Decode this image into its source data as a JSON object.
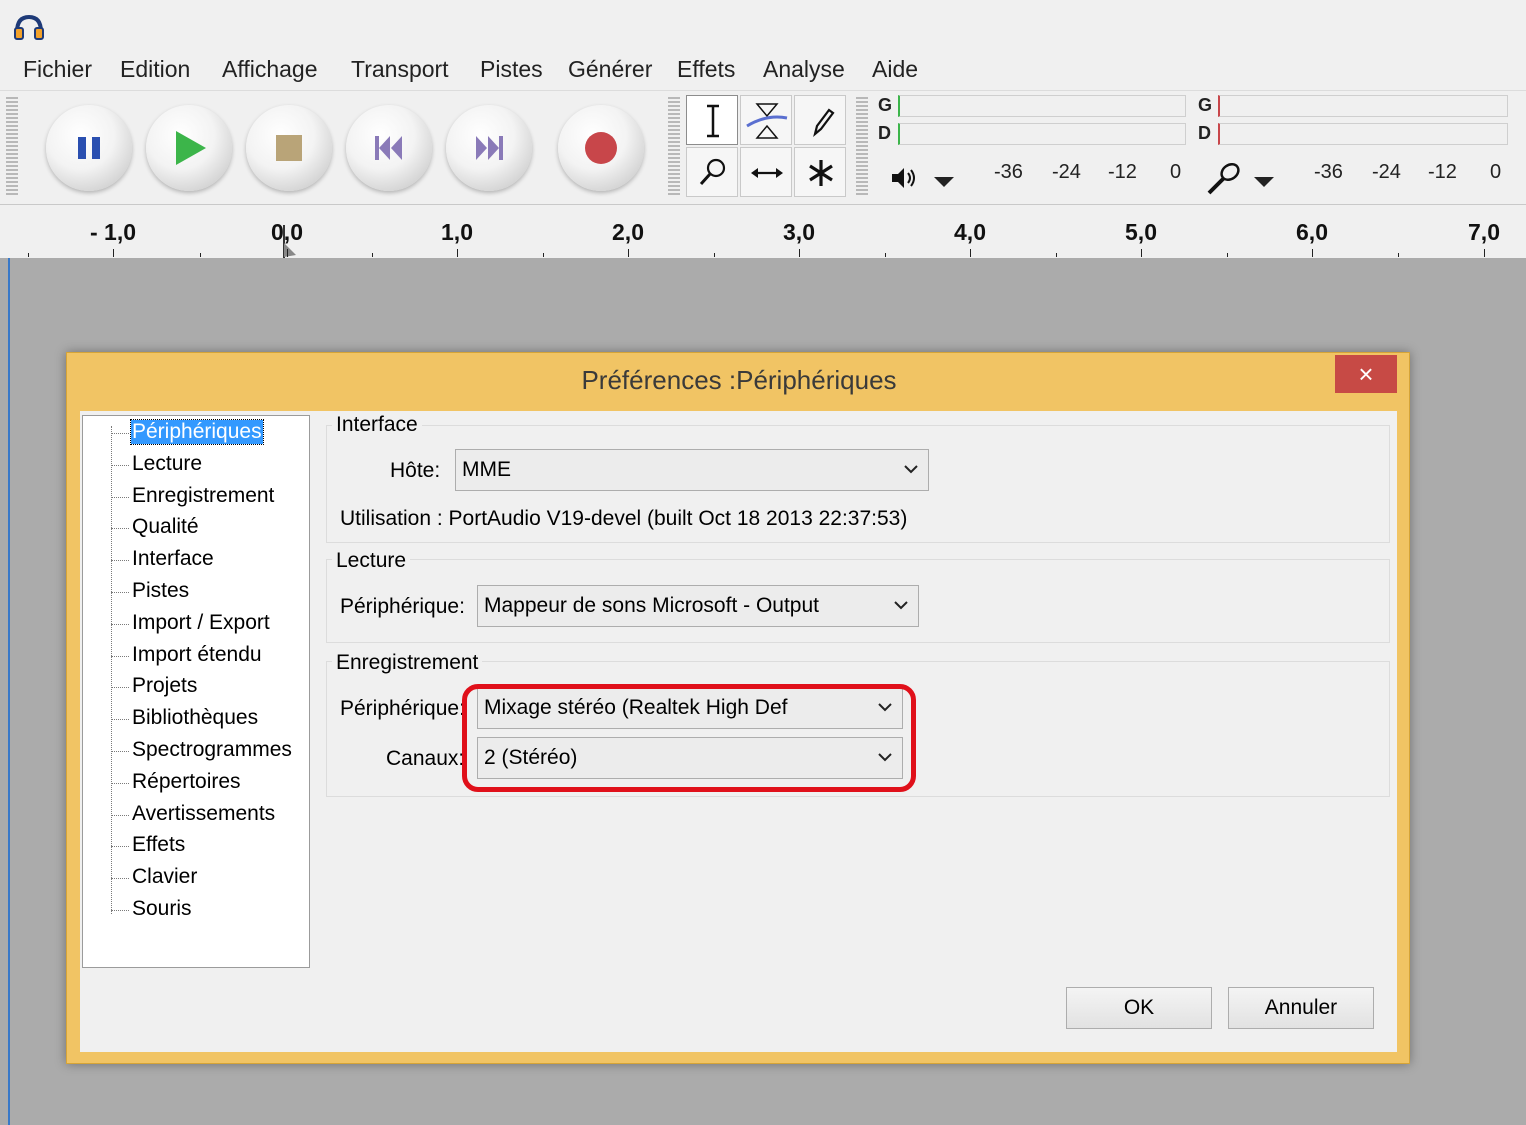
{
  "menu": [
    "Fichier",
    "Edition",
    "Affichage",
    "Transport",
    "Pistes",
    "Générer",
    "Effets",
    "Analyse",
    "Aide"
  ],
  "meters": {
    "left_channel": "G",
    "right_channel": "D",
    "ticks": [
      "-36",
      "-24",
      "-12",
      "0"
    ],
    "playback_icon": "speaker-icon",
    "record_icon": "microphone-icon"
  },
  "ruler": {
    "labels": [
      "- 1,0",
      "0,0",
      "1,0",
      "2,0",
      "3,0",
      "4,0",
      "5,0",
      "6,0",
      "7,0"
    ]
  },
  "dialog": {
    "title": "Préférences :Périphériques",
    "close_label": "×",
    "tree": [
      "Périphériques",
      "Lecture",
      "Enregistrement",
      "Qualité",
      "Interface",
      "Pistes",
      "Import / Export",
      "Import étendu",
      "Projets",
      "Bibliothèques",
      "Spectrogrammes",
      "Répertoires",
      "Avertissements",
      "Effets",
      "Clavier",
      "Souris"
    ],
    "selected_tree_item": "Périphériques",
    "interface": {
      "group_title": "Interface",
      "host_label": "Hôte:",
      "host_value": "MME",
      "info": "Utilisation : PortAudio V19-devel (built Oct 18 2013 22:37:53)"
    },
    "playback": {
      "group_title": "Lecture",
      "device_label": "Périphérique:",
      "device_value": "Mappeur de sons Microsoft - Output"
    },
    "recording": {
      "group_title": "Enregistrement",
      "device_label": "Périphérique:",
      "device_value": "Mixage stéréo (Realtek High Def",
      "channels_label": "Canaux:",
      "channels_value": "2 (Stéréo)"
    },
    "ok_label": "OK",
    "cancel_label": "Annuler"
  },
  "colors": {
    "dialog_frame": "#f1c464",
    "close_button": "#c74a45",
    "selection": "#3399ff",
    "highlight": "#e0101a",
    "play": "#3cb54a",
    "record": "#c8464a",
    "transport_blue": "#2a4fb0"
  }
}
